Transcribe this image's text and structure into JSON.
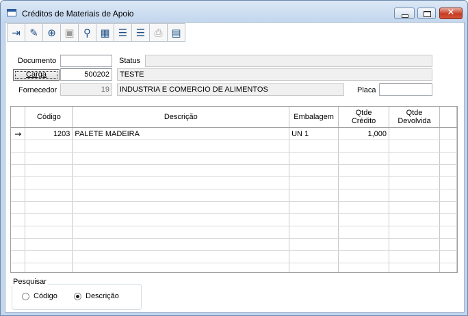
{
  "window": {
    "title": "Créditos de Materiais de Apoio"
  },
  "toolbar": {
    "buttons": [
      {
        "icon": "exit-icon",
        "glyph": "⇥",
        "enabled": true
      },
      {
        "icon": "eraser-icon",
        "glyph": "✎",
        "enabled": true
      },
      {
        "icon": "add-icon",
        "glyph": "⊕",
        "enabled": true
      },
      {
        "icon": "save-icon",
        "glyph": "▣",
        "enabled": false
      },
      {
        "icon": "search-icon",
        "glyph": "⚲",
        "enabled": true
      },
      {
        "icon": "grid-icon",
        "glyph": "▦",
        "enabled": true
      },
      {
        "icon": "add-row-icon",
        "glyph": "☰",
        "enabled": true
      },
      {
        "icon": "remove-row-icon",
        "glyph": "☰",
        "enabled": true
      },
      {
        "icon": "print-icon",
        "glyph": "⎙",
        "enabled": false
      },
      {
        "icon": "document-icon",
        "glyph": "▤",
        "enabled": true
      }
    ]
  },
  "form": {
    "documento_label": "Documento",
    "documento_value": "",
    "status_label": "Status",
    "status_value": "",
    "carga_button": "Carga",
    "carga_value": "500202",
    "carga_desc": "TESTE",
    "fornecedor_label": "Fornecedor",
    "fornecedor_code": "19",
    "fornecedor_name": "INDUSTRIA E COMERCIO DE ALIMENTOS",
    "placa_label": "Placa",
    "placa_value": ""
  },
  "grid": {
    "columns": [
      "Código",
      "Descrição",
      "Embalagem",
      "Qtde\nCrédito",
      "Qtde\nDevolvida"
    ],
    "indicator": "→",
    "rows": [
      {
        "codigo": "1203",
        "descricao": "PALETE MADEIRA",
        "embalagem": "UN 1",
        "qtde_credito": "1,000",
        "qtde_devolvida": ""
      }
    ]
  },
  "search": {
    "title": "Pesquisar",
    "options": [
      {
        "label": "Código",
        "selected": false
      },
      {
        "label": "Descrição",
        "selected": true
      }
    ]
  }
}
